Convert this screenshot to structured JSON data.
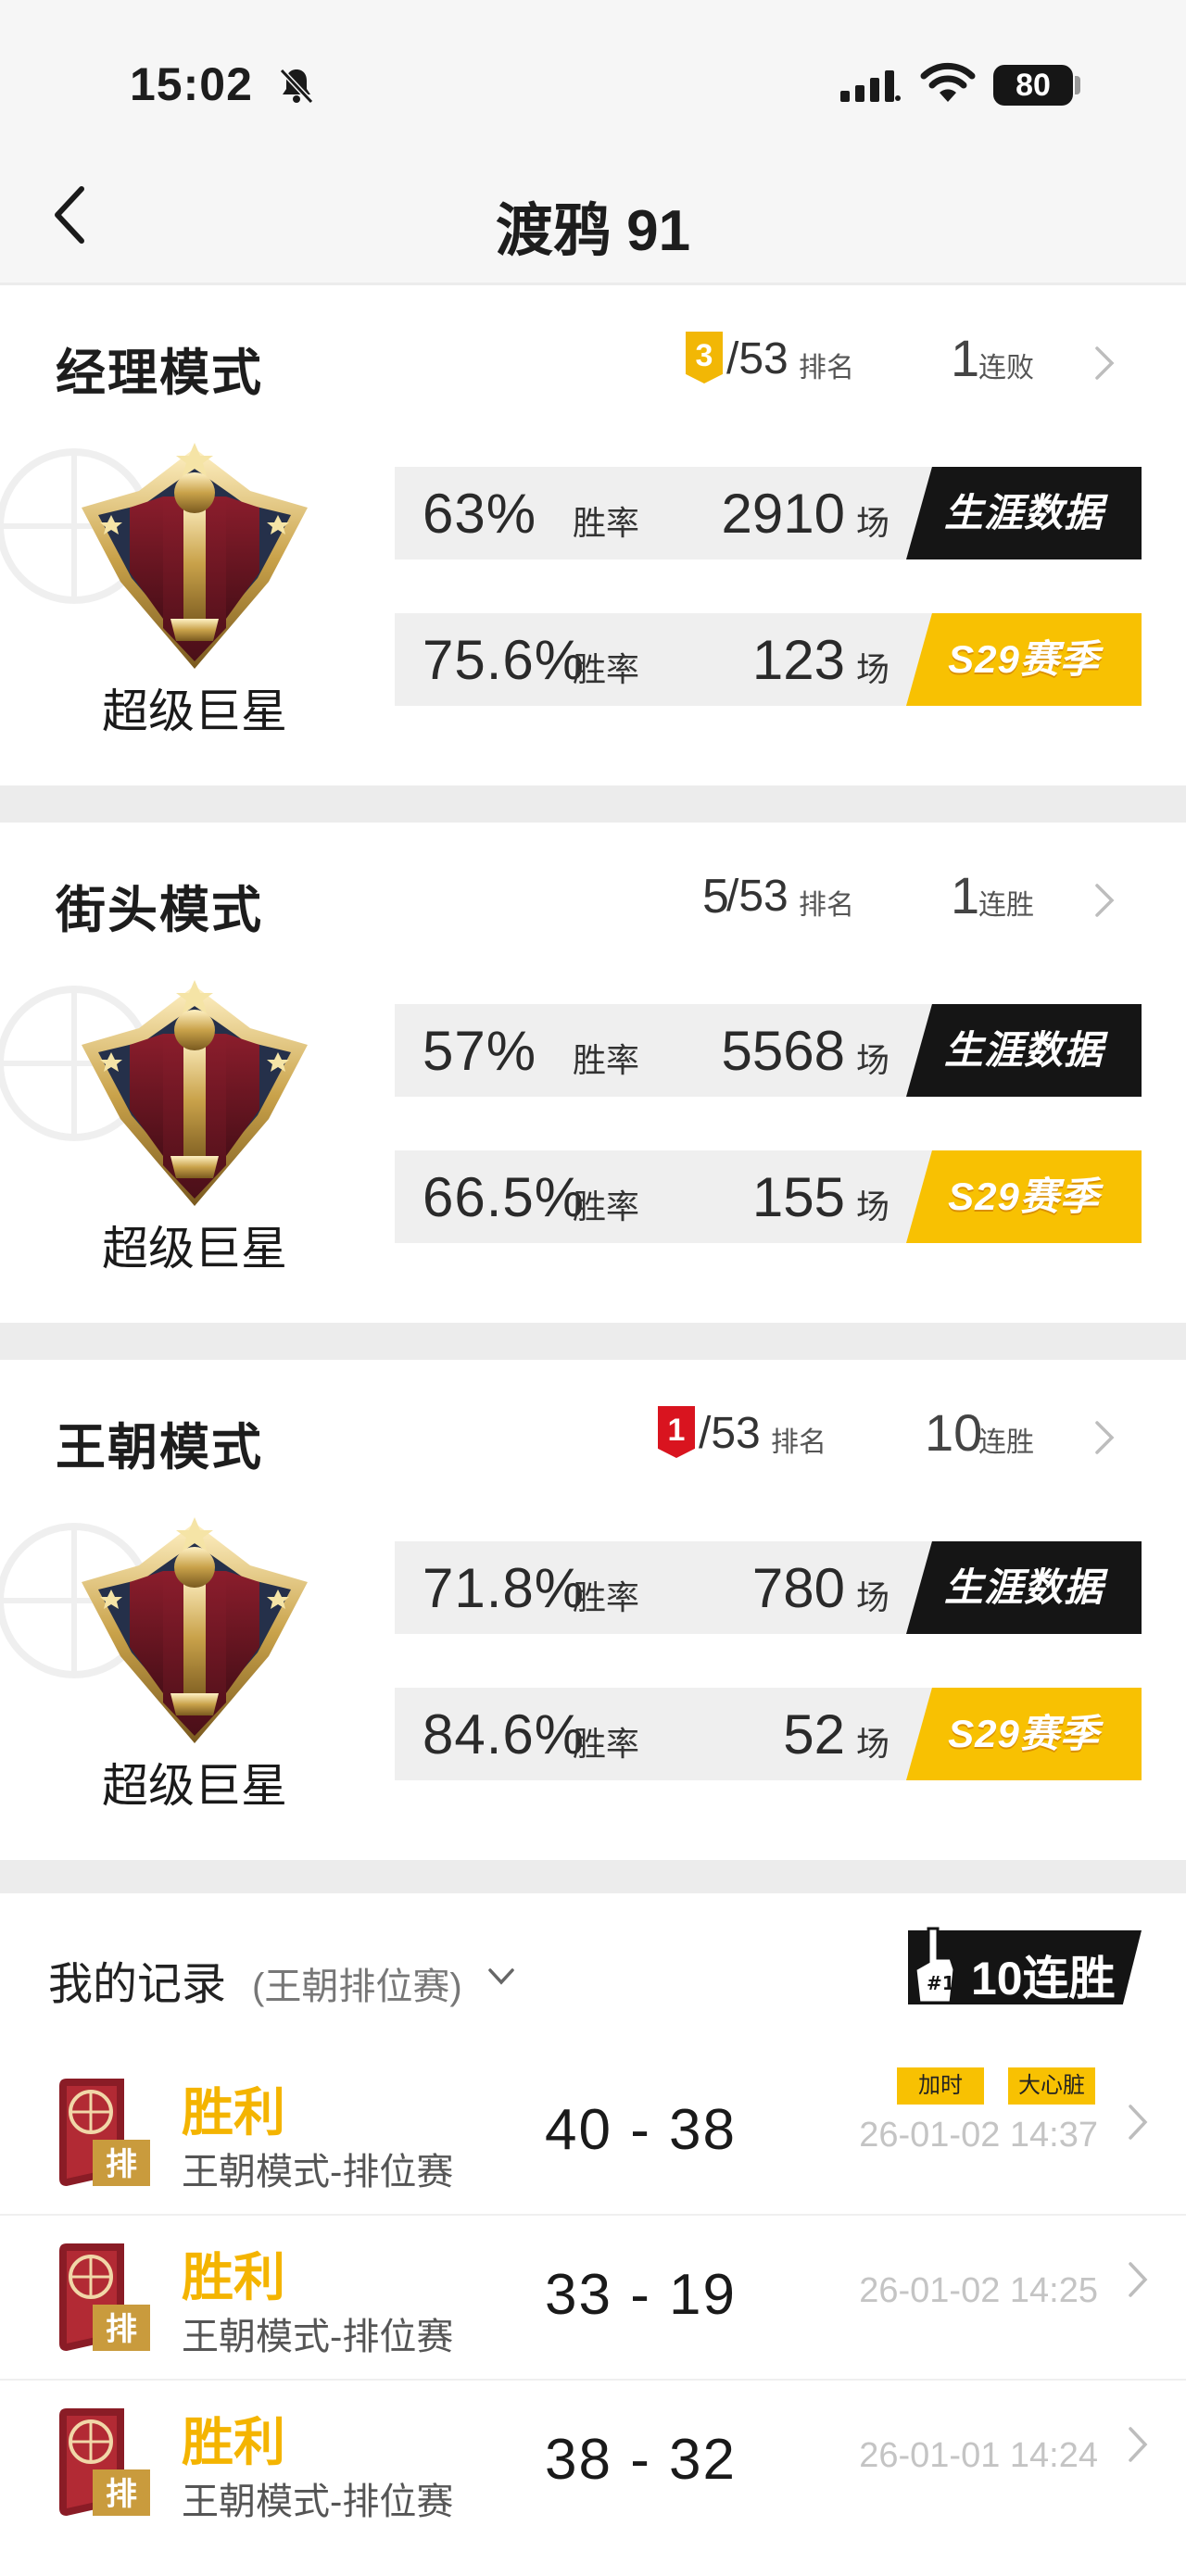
{
  "status_bar": {
    "time": "15:02",
    "battery": "80"
  },
  "header": {
    "title": "渡鸦 91"
  },
  "modes": [
    {
      "name": "经理模式",
      "rank": "3",
      "rank_highlight": true,
      "rank_color": "#f2b705",
      "rank_total": "/53",
      "rank_label": "排名",
      "streak_count": "1",
      "streak_label": "连败",
      "tier": "超级巨星",
      "career": {
        "pct": "63%",
        "pct_label": "胜率",
        "games": "2910",
        "games_label": "场",
        "tag": "生涯数据"
      },
      "season": {
        "pct": "75.6%",
        "pct_label": "胜率",
        "games": "123",
        "games_label": "场",
        "tag": "S29赛季"
      }
    },
    {
      "name": "街头模式",
      "rank": "5",
      "rank_highlight": false,
      "rank_total": "/53",
      "rank_label": "排名",
      "streak_count": "1",
      "streak_label": "连胜",
      "tier": "超级巨星",
      "career": {
        "pct": "57%",
        "pct_label": "胜率",
        "games": "5568",
        "games_label": "场",
        "tag": "生涯数据"
      },
      "season": {
        "pct": "66.5%",
        "pct_label": "胜率",
        "games": "155",
        "games_label": "场",
        "tag": "S29赛季"
      }
    },
    {
      "name": "王朝模式",
      "rank": "1",
      "rank_highlight": true,
      "rank_color": "#d9141f",
      "rank_total": "/53",
      "rank_label": "排名",
      "streak_count": "10",
      "streak_label": "连胜",
      "tier": "超级巨星",
      "career": {
        "pct": "71.8%",
        "pct_label": "胜率",
        "games": "780",
        "games_label": "场",
        "tag": "生涯数据"
      },
      "season": {
        "pct": "84.6%",
        "pct_label": "胜率",
        "games": "52",
        "games_label": "场",
        "tag": "S29赛季"
      }
    }
  ],
  "records": {
    "title": "我的记录",
    "subtitle": "(王朝排位赛)",
    "streak_badge": "10连胜",
    "icon_label": "排",
    "items": [
      {
        "result": "胜利",
        "mode": "王朝模式-排位赛",
        "score": "40 - 38",
        "date": "26-01-02 14:37",
        "tags": [
          "加时",
          "大心脏"
        ]
      },
      {
        "result": "胜利",
        "mode": "王朝模式-排位赛",
        "score": "33 - 19",
        "date": "26-01-02 14:25",
        "tags": []
      },
      {
        "result": "胜利",
        "mode": "王朝模式-排位赛",
        "score": "38 - 32",
        "date": "26-01-01 14:24",
        "tags": []
      }
    ]
  },
  "colors": {
    "accent_yellow": "#f8c102",
    "rank_red": "#d9141f",
    "rank_gold": "#f2b705",
    "dark": "#151515"
  }
}
